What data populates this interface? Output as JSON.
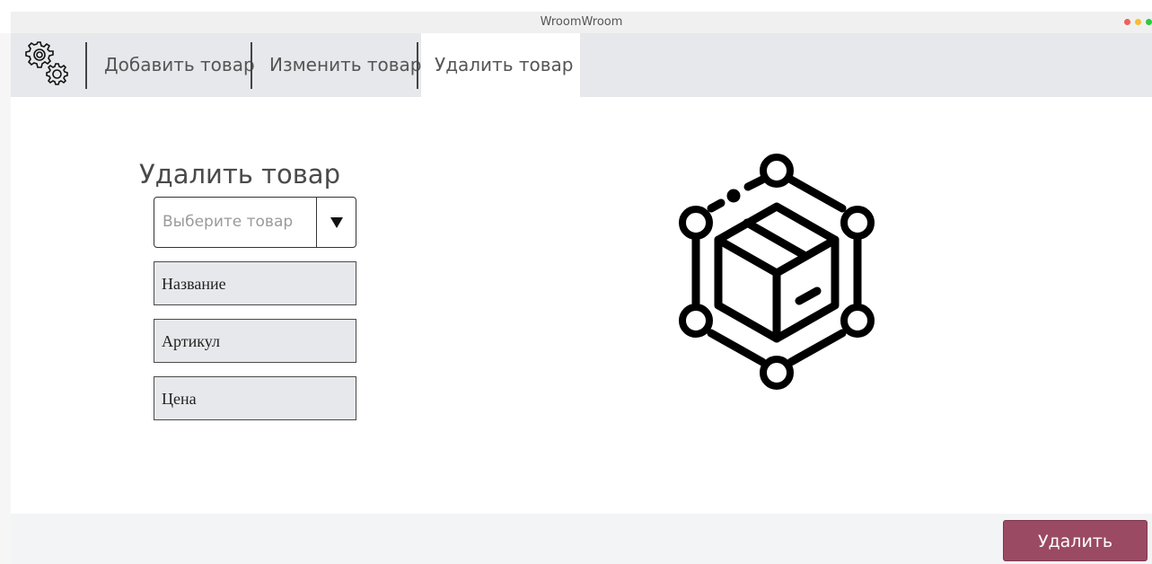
{
  "window": {
    "title": "WroomWroom"
  },
  "tabs": [
    {
      "label": "Добавить товар"
    },
    {
      "label": "Изменить товар"
    },
    {
      "label": "Удалить товар"
    }
  ],
  "form": {
    "title": "Удалить товар",
    "select_placeholder": "Выберите товар",
    "fields": [
      {
        "label": "Название"
      },
      {
        "label": "Артикул"
      },
      {
        "label": "Цена"
      }
    ]
  },
  "footer": {
    "delete_label": "Удалить"
  },
  "icons": {
    "settings": "gears-icon",
    "dropdown": "triangle-down-icon",
    "illustration": "box-network-icon"
  },
  "colors": {
    "accent": "#9b4a63",
    "topbar": "#e6e8eb",
    "field_bg": "#e6e8eb"
  }
}
